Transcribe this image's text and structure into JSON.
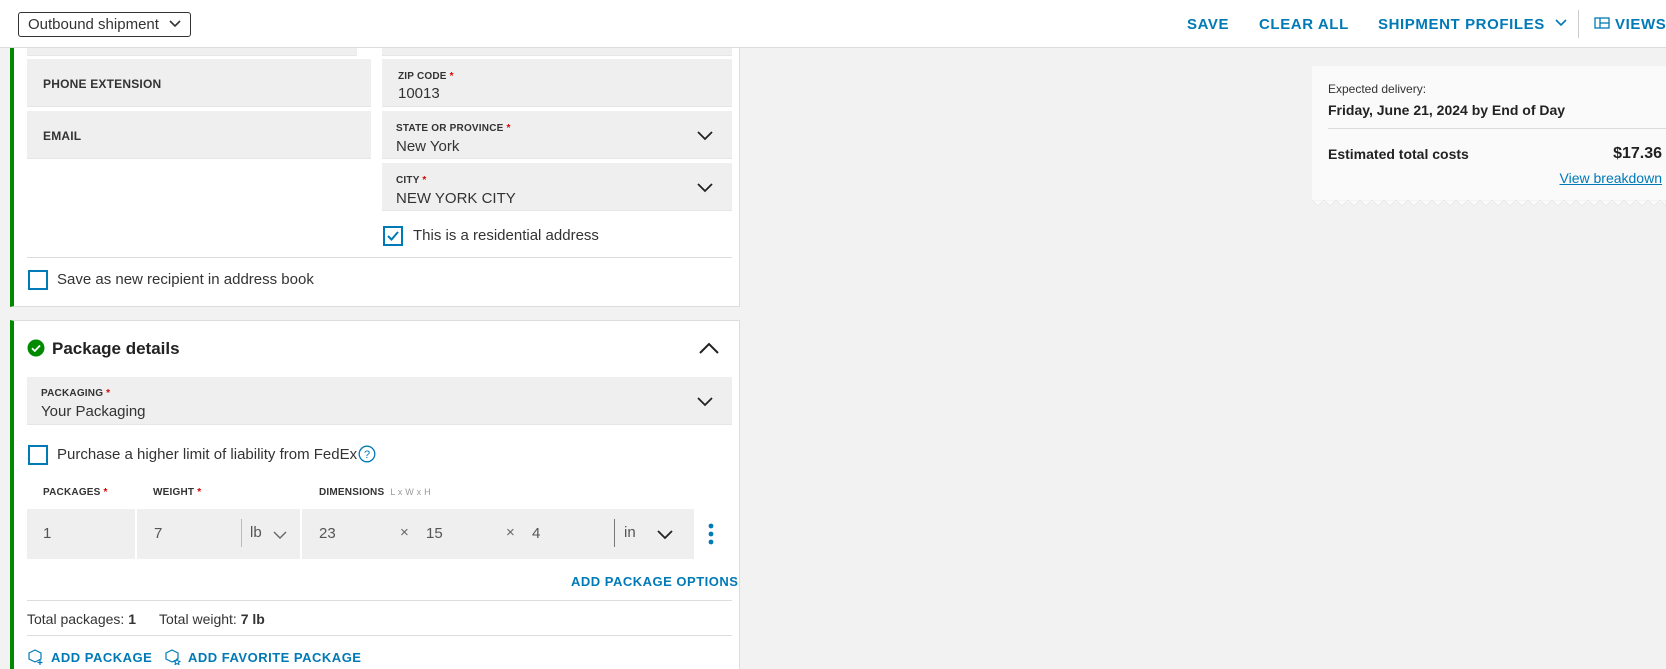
{
  "topbar": {
    "shipment_type": "Outbound shipment",
    "save": "SAVE",
    "clear_all": "CLEAR ALL",
    "shipment_profiles": "SHIPMENT PROFILES",
    "views": "VIEWS"
  },
  "recipient": {
    "phone_extension_label": "PHONE EXTENSION",
    "email_label": "EMAIL",
    "zip_label": "ZIP CODE",
    "zip_value": "10013",
    "state_label": "STATE OR PROVINCE",
    "state_value": "New York",
    "city_label": "CITY",
    "city_value": "NEW YORK CITY",
    "required_mark": "*",
    "residential_label": "This is a residential address",
    "residential_checked": true,
    "save_recipient_label": "Save as new recipient in address book",
    "save_recipient_checked": false
  },
  "package": {
    "title": "Package details",
    "packaging_label": "PACKAGING",
    "packaging_value": "Your Packaging",
    "liability_label": "Purchase a higher limit of liability from FedEx",
    "liability_checked": false,
    "packages_label": "PACKAGES",
    "weight_label": "WEIGHT",
    "dimensions_label": "DIMENSIONS",
    "dimensions_hint": "L x W x H",
    "packages_value": "1",
    "weight_value": "7",
    "weight_unit": "lb",
    "dim_l": "23",
    "dim_w": "15",
    "dim_h": "4",
    "dim_sep": "×",
    "dim_unit": "in",
    "add_options": "ADD PACKAGE OPTIONS",
    "total_packages_label": "Total packages:",
    "total_packages_value": "1",
    "total_weight_label": "Total weight:",
    "total_weight_value": "7 lb",
    "add_package": "ADD PACKAGE",
    "add_favorite": "ADD FAVORITE PACKAGE"
  },
  "summary": {
    "expected_label": "Expected delivery:",
    "expected_value": "Friday, June 21, 2024 by End of Day",
    "cost_label": "Estimated total costs",
    "cost_value": "$17.36",
    "breakdown_link": "View breakdown"
  },
  "colors": {
    "accent": "#007ab7",
    "success": "#008a00",
    "required": "#d00000"
  }
}
